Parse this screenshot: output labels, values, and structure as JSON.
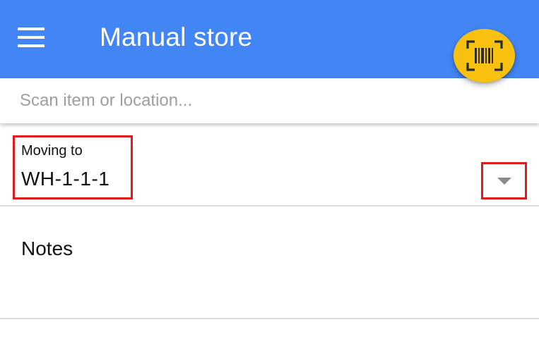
{
  "app_bar": {
    "title": "Manual store",
    "background_color": "#4285f4",
    "menu_icon": "hamburger-menu-icon"
  },
  "scan_button": {
    "icon": "barcode-scan-icon",
    "color": "#f9c10f"
  },
  "search": {
    "placeholder": "Scan item or location...",
    "value": ""
  },
  "moving_to": {
    "label": "Moving to",
    "value": "WH-1-1-1",
    "dropdown_icon": "caret-down-icon",
    "highlight_color": "#e01b1b"
  },
  "notes": {
    "label": "Notes"
  }
}
